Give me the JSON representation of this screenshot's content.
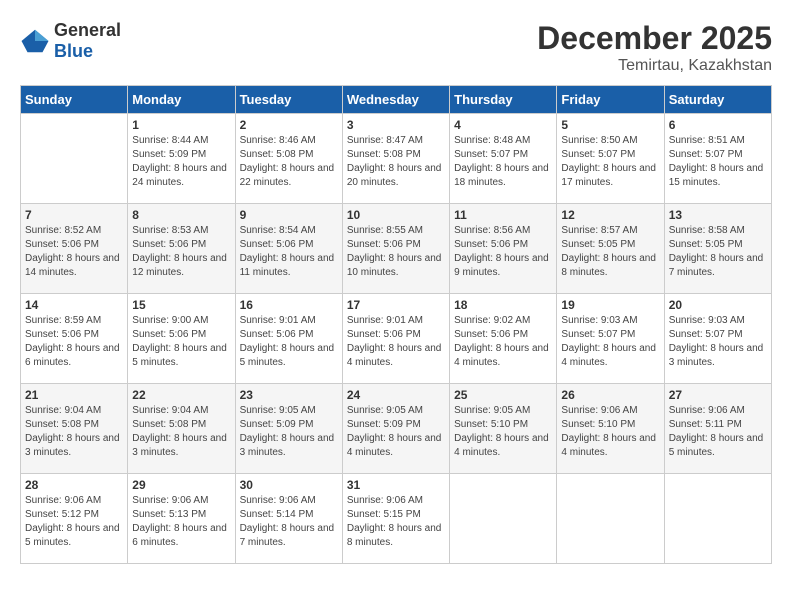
{
  "header": {
    "logo_general": "General",
    "logo_blue": "Blue",
    "month": "December 2025",
    "location": "Temirtau, Kazakhstan"
  },
  "days_of_week": [
    "Sunday",
    "Monday",
    "Tuesday",
    "Wednesday",
    "Thursday",
    "Friday",
    "Saturday"
  ],
  "weeks": [
    [
      {
        "day": "",
        "sunrise": "",
        "sunset": "",
        "daylight": ""
      },
      {
        "day": "1",
        "sunrise": "Sunrise: 8:44 AM",
        "sunset": "Sunset: 5:09 PM",
        "daylight": "Daylight: 8 hours and 24 minutes."
      },
      {
        "day": "2",
        "sunrise": "Sunrise: 8:46 AM",
        "sunset": "Sunset: 5:08 PM",
        "daylight": "Daylight: 8 hours and 22 minutes."
      },
      {
        "day": "3",
        "sunrise": "Sunrise: 8:47 AM",
        "sunset": "Sunset: 5:08 PM",
        "daylight": "Daylight: 8 hours and 20 minutes."
      },
      {
        "day": "4",
        "sunrise": "Sunrise: 8:48 AM",
        "sunset": "Sunset: 5:07 PM",
        "daylight": "Daylight: 8 hours and 18 minutes."
      },
      {
        "day": "5",
        "sunrise": "Sunrise: 8:50 AM",
        "sunset": "Sunset: 5:07 PM",
        "daylight": "Daylight: 8 hours and 17 minutes."
      },
      {
        "day": "6",
        "sunrise": "Sunrise: 8:51 AM",
        "sunset": "Sunset: 5:07 PM",
        "daylight": "Daylight: 8 hours and 15 minutes."
      }
    ],
    [
      {
        "day": "7",
        "sunrise": "Sunrise: 8:52 AM",
        "sunset": "Sunset: 5:06 PM",
        "daylight": "Daylight: 8 hours and 14 minutes."
      },
      {
        "day": "8",
        "sunrise": "Sunrise: 8:53 AM",
        "sunset": "Sunset: 5:06 PM",
        "daylight": "Daylight: 8 hours and 12 minutes."
      },
      {
        "day": "9",
        "sunrise": "Sunrise: 8:54 AM",
        "sunset": "Sunset: 5:06 PM",
        "daylight": "Daylight: 8 hours and 11 minutes."
      },
      {
        "day": "10",
        "sunrise": "Sunrise: 8:55 AM",
        "sunset": "Sunset: 5:06 PM",
        "daylight": "Daylight: 8 hours and 10 minutes."
      },
      {
        "day": "11",
        "sunrise": "Sunrise: 8:56 AM",
        "sunset": "Sunset: 5:06 PM",
        "daylight": "Daylight: 8 hours and 9 minutes."
      },
      {
        "day": "12",
        "sunrise": "Sunrise: 8:57 AM",
        "sunset": "Sunset: 5:05 PM",
        "daylight": "Daylight: 8 hours and 8 minutes."
      },
      {
        "day": "13",
        "sunrise": "Sunrise: 8:58 AM",
        "sunset": "Sunset: 5:05 PM",
        "daylight": "Daylight: 8 hours and 7 minutes."
      }
    ],
    [
      {
        "day": "14",
        "sunrise": "Sunrise: 8:59 AM",
        "sunset": "Sunset: 5:06 PM",
        "daylight": "Daylight: 8 hours and 6 minutes."
      },
      {
        "day": "15",
        "sunrise": "Sunrise: 9:00 AM",
        "sunset": "Sunset: 5:06 PM",
        "daylight": "Daylight: 8 hours and 5 minutes."
      },
      {
        "day": "16",
        "sunrise": "Sunrise: 9:01 AM",
        "sunset": "Sunset: 5:06 PM",
        "daylight": "Daylight: 8 hours and 5 minutes."
      },
      {
        "day": "17",
        "sunrise": "Sunrise: 9:01 AM",
        "sunset": "Sunset: 5:06 PM",
        "daylight": "Daylight: 8 hours and 4 minutes."
      },
      {
        "day": "18",
        "sunrise": "Sunrise: 9:02 AM",
        "sunset": "Sunset: 5:06 PM",
        "daylight": "Daylight: 8 hours and 4 minutes."
      },
      {
        "day": "19",
        "sunrise": "Sunrise: 9:03 AM",
        "sunset": "Sunset: 5:07 PM",
        "daylight": "Daylight: 8 hours and 4 minutes."
      },
      {
        "day": "20",
        "sunrise": "Sunrise: 9:03 AM",
        "sunset": "Sunset: 5:07 PM",
        "daylight": "Daylight: 8 hours and 3 minutes."
      }
    ],
    [
      {
        "day": "21",
        "sunrise": "Sunrise: 9:04 AM",
        "sunset": "Sunset: 5:08 PM",
        "daylight": "Daylight: 8 hours and 3 minutes."
      },
      {
        "day": "22",
        "sunrise": "Sunrise: 9:04 AM",
        "sunset": "Sunset: 5:08 PM",
        "daylight": "Daylight: 8 hours and 3 minutes."
      },
      {
        "day": "23",
        "sunrise": "Sunrise: 9:05 AM",
        "sunset": "Sunset: 5:09 PM",
        "daylight": "Daylight: 8 hours and 3 minutes."
      },
      {
        "day": "24",
        "sunrise": "Sunrise: 9:05 AM",
        "sunset": "Sunset: 5:09 PM",
        "daylight": "Daylight: 8 hours and 4 minutes."
      },
      {
        "day": "25",
        "sunrise": "Sunrise: 9:05 AM",
        "sunset": "Sunset: 5:10 PM",
        "daylight": "Daylight: 8 hours and 4 minutes."
      },
      {
        "day": "26",
        "sunrise": "Sunrise: 9:06 AM",
        "sunset": "Sunset: 5:10 PM",
        "daylight": "Daylight: 8 hours and 4 minutes."
      },
      {
        "day": "27",
        "sunrise": "Sunrise: 9:06 AM",
        "sunset": "Sunset: 5:11 PM",
        "daylight": "Daylight: 8 hours and 5 minutes."
      }
    ],
    [
      {
        "day": "28",
        "sunrise": "Sunrise: 9:06 AM",
        "sunset": "Sunset: 5:12 PM",
        "daylight": "Daylight: 8 hours and 5 minutes."
      },
      {
        "day": "29",
        "sunrise": "Sunrise: 9:06 AM",
        "sunset": "Sunset: 5:13 PM",
        "daylight": "Daylight: 8 hours and 6 minutes."
      },
      {
        "day": "30",
        "sunrise": "Sunrise: 9:06 AM",
        "sunset": "Sunset: 5:14 PM",
        "daylight": "Daylight: 8 hours and 7 minutes."
      },
      {
        "day": "31",
        "sunrise": "Sunrise: 9:06 AM",
        "sunset": "Sunset: 5:15 PM",
        "daylight": "Daylight: 8 hours and 8 minutes."
      },
      {
        "day": "",
        "sunrise": "",
        "sunset": "",
        "daylight": ""
      },
      {
        "day": "",
        "sunrise": "",
        "sunset": "",
        "daylight": ""
      },
      {
        "day": "",
        "sunrise": "",
        "sunset": "",
        "daylight": ""
      }
    ]
  ]
}
